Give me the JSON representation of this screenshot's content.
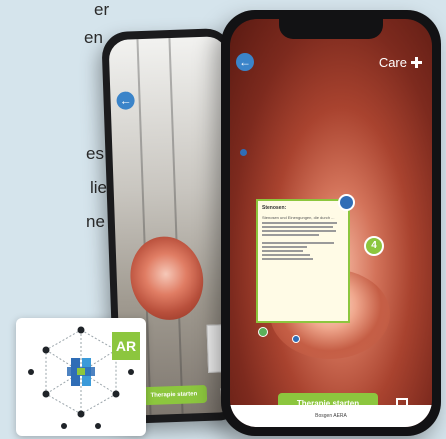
{
  "background_text": [
    "er",
    "en",
    "es",
    "lie",
    "ne"
  ],
  "front_phone": {
    "brand": "Care",
    "info_card": {
      "title": "Stenosen:",
      "body": "Stenosen und Einengungen, die durch ..."
    },
    "badge_number": "4",
    "cta_label": "Therapie starten",
    "footer_text": "Bosgen AERA"
  },
  "back_phone": {
    "cta_label": "Therapie starten"
  },
  "logo_card": {
    "ar_label": "AR"
  },
  "colors": {
    "accent_green": "#8cc63e",
    "accent_blue": "#3b84c9",
    "background": "#d5e4ec"
  },
  "icons": [
    "back-arrow-icon",
    "fullscreen-icon",
    "close-icon",
    "care-cross-icon",
    "ar-hex-logo-icon"
  ]
}
